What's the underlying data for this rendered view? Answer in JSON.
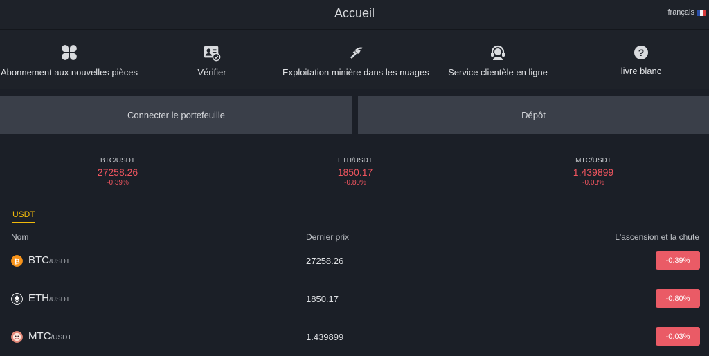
{
  "header": {
    "title": "Accueil",
    "language": "français"
  },
  "colors": {
    "accent": "#f0b90b",
    "down": "#f0555f",
    "badge": "#ea5b66",
    "button": "#3a3f49"
  },
  "shortcuts": [
    {
      "icon": "four-leaf-icon",
      "label": "Abonnement aux nouvelles pièces"
    },
    {
      "icon": "id-card-verify-icon",
      "label": "Vérifier"
    },
    {
      "icon": "mining-icon",
      "label": "Exploitation minière dans les nuages"
    },
    {
      "icon": "headset-icon",
      "label": "Service clientèle en ligne"
    },
    {
      "icon": "question-icon",
      "label": "livre blanc"
    }
  ],
  "actions": {
    "connect": "Connecter le portefeuille",
    "deposit": "Dépôt"
  },
  "ticker": [
    {
      "pair": "BTC/USDT",
      "price": "27258.26",
      "change": "-0.39%"
    },
    {
      "pair": "ETH/USDT",
      "price": "1850.17",
      "change": "-0.80%"
    },
    {
      "pair": "MTC/USDT",
      "price": "1.439899",
      "change": "-0.03%"
    }
  ],
  "market": {
    "tab": "USDT",
    "columns": {
      "name": "Nom",
      "price": "Dernier prix",
      "change": "L'ascension et la chute"
    },
    "rows": [
      {
        "base": "BTC",
        "quote": "/USDT",
        "price": "27258.26",
        "change": "-0.39%",
        "icon": "bitcoin-icon"
      },
      {
        "base": "ETH",
        "quote": "/USDT",
        "price": "1850.17",
        "change": "-0.80%",
        "icon": "ethereum-icon"
      },
      {
        "base": "MTC",
        "quote": "/USDT",
        "price": "1.439899",
        "change": "-0.03%",
        "icon": "mtc-icon"
      }
    ]
  }
}
